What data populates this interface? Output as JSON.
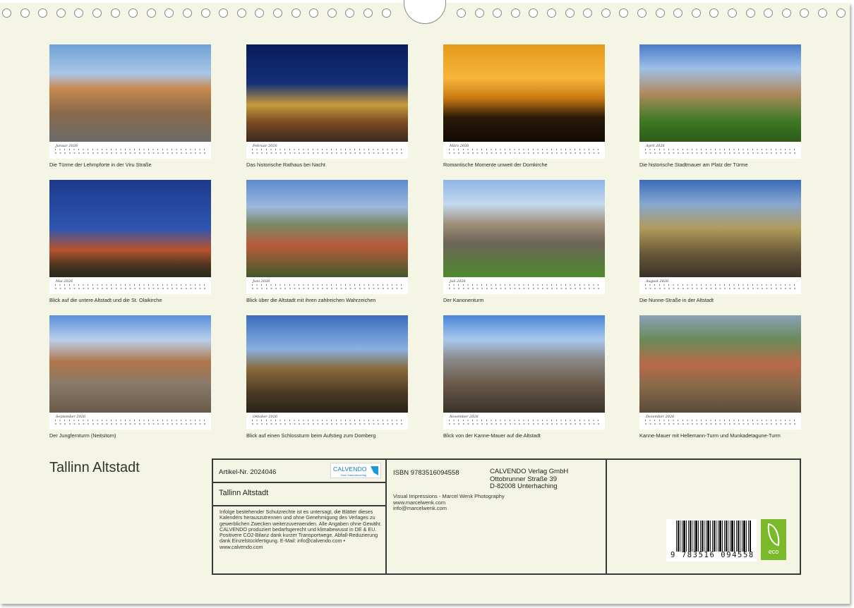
{
  "title": "Tallinn Altstadt",
  "months": [
    {
      "name": "Januar 2026",
      "caption": "Die Türme der Lehmpforte in der Viru Straße"
    },
    {
      "name": "Februar 2026",
      "caption": "Das historische Rathaus bei Nacht"
    },
    {
      "name": "März 2026",
      "caption": "Romantische Momente unweit der Domkirche"
    },
    {
      "name": "April 2026",
      "caption": "Die historische Stadtmauer am Platz der Türme"
    },
    {
      "name": "Mai 2026",
      "caption": "Blick auf die untere Altstadt und die St. Olaikirche"
    },
    {
      "name": "Juni 2026",
      "caption": "Blick über die Altstadt mit ihren zahlreichen Wahrzeichen"
    },
    {
      "name": "Juli 2026",
      "caption": "Der Kanonenturm"
    },
    {
      "name": "August 2026",
      "caption": "Die Nunne-Straße in der Altstadt"
    },
    {
      "name": "September 2026",
      "caption": "Der Jungfernturm (Neitsitorn)"
    },
    {
      "name": "Oktober 2026",
      "caption": "Blick auf einen Schlossturm beim Aufstieg zum Domberg"
    },
    {
      "name": "November 2026",
      "caption": "Blick von der Kanne-Mauer auf die Altstadt"
    },
    {
      "name": "Dezember 2026",
      "caption": "Kanne-Mauer mit Hellemann-Turm und Munkadetagune-Turm"
    }
  ],
  "info": {
    "article": "Artikel-Nr. 2024046",
    "logo_name": "CALVENDO",
    "logo_tagline": "Dein Kalenderverlag",
    "subtitle": "Tallinn Altstadt",
    "legal": "Infolge bestehender Schutzrechte ist es untersagt, die Blätter dieses Kalenders herauszutrennen und ohne Genehmigung des Verlages zu gewerblichen Zwecken weiterzuverwenden. Alle Angaben ohne Gewähr. CALVENDO produziert bedarfsgerecht und klimabewusst in DE & EU. Positivere CO2-Bilanz dank kurzer Transportwege. Abfall-Reduzierung dank Einzelstückfertigung. E-Mail: info@calvendo.com • www.calvendo.com",
    "isbn": "ISBN 9783516094558",
    "publisher": [
      "CALVENDO Verlag GmbH",
      "Ottobrunner Straße 39",
      "D-82008 Unterhaching"
    ],
    "credits": [
      "Visual Impressions - Marcel Wenk Photography",
      "www.marcelwenk.com",
      "info@marcelwenk.com"
    ],
    "barcode_number": "9 783516 094558",
    "eco_label": "eco"
  }
}
